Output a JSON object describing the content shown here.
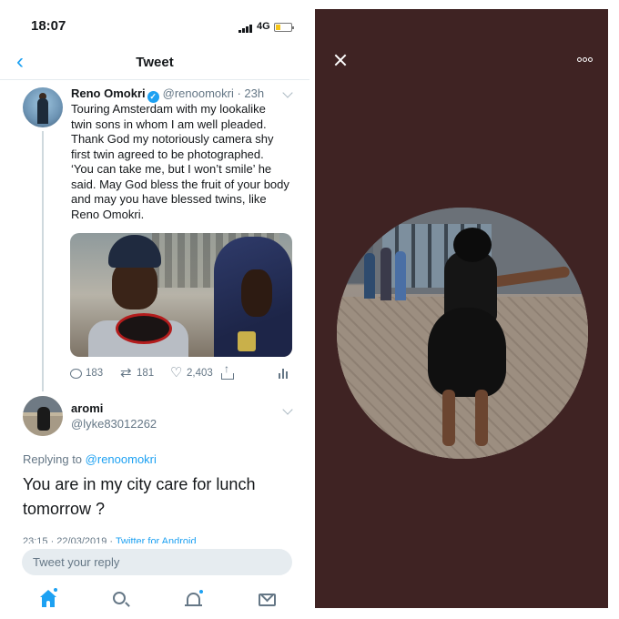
{
  "status_bar": {
    "time": "18:07",
    "network": "4G"
  },
  "nav": {
    "title": "Tweet"
  },
  "tweet": {
    "name": "Reno Omokri",
    "verified_glyph": "✓",
    "handle_time": "@renoomokri · 23h",
    "text": "Touring Amsterdam with my lookalike twin sons in whom I am well pleaded. Thank God my notoriously camera shy first twin agreed to be photographed. ‘You can take me, but I won’t smile’ he said. May God bless the fruit of your body and may you have blessed twins, like Reno Omokri.",
    "stats": {
      "replies": "183",
      "retweets": "181",
      "likes": "2,403"
    }
  },
  "reply": {
    "name": "aromi",
    "handle": "@lyke83012262",
    "replying_prefix": "Replying to",
    "replying_to": "@renoomokri",
    "text": "You are in my city care for lunch tomorrow ?",
    "timestamp": "23:15 · 22/03/2019 ·",
    "source": "Twitter for Android"
  },
  "composer": {
    "placeholder": "Tweet your reply"
  },
  "tabs": [
    "home-icon",
    "search-icon",
    "notifications-icon",
    "messages-icon"
  ],
  "colors": {
    "accent": "#1da1f2",
    "viewer_bg": "#3f2323"
  }
}
